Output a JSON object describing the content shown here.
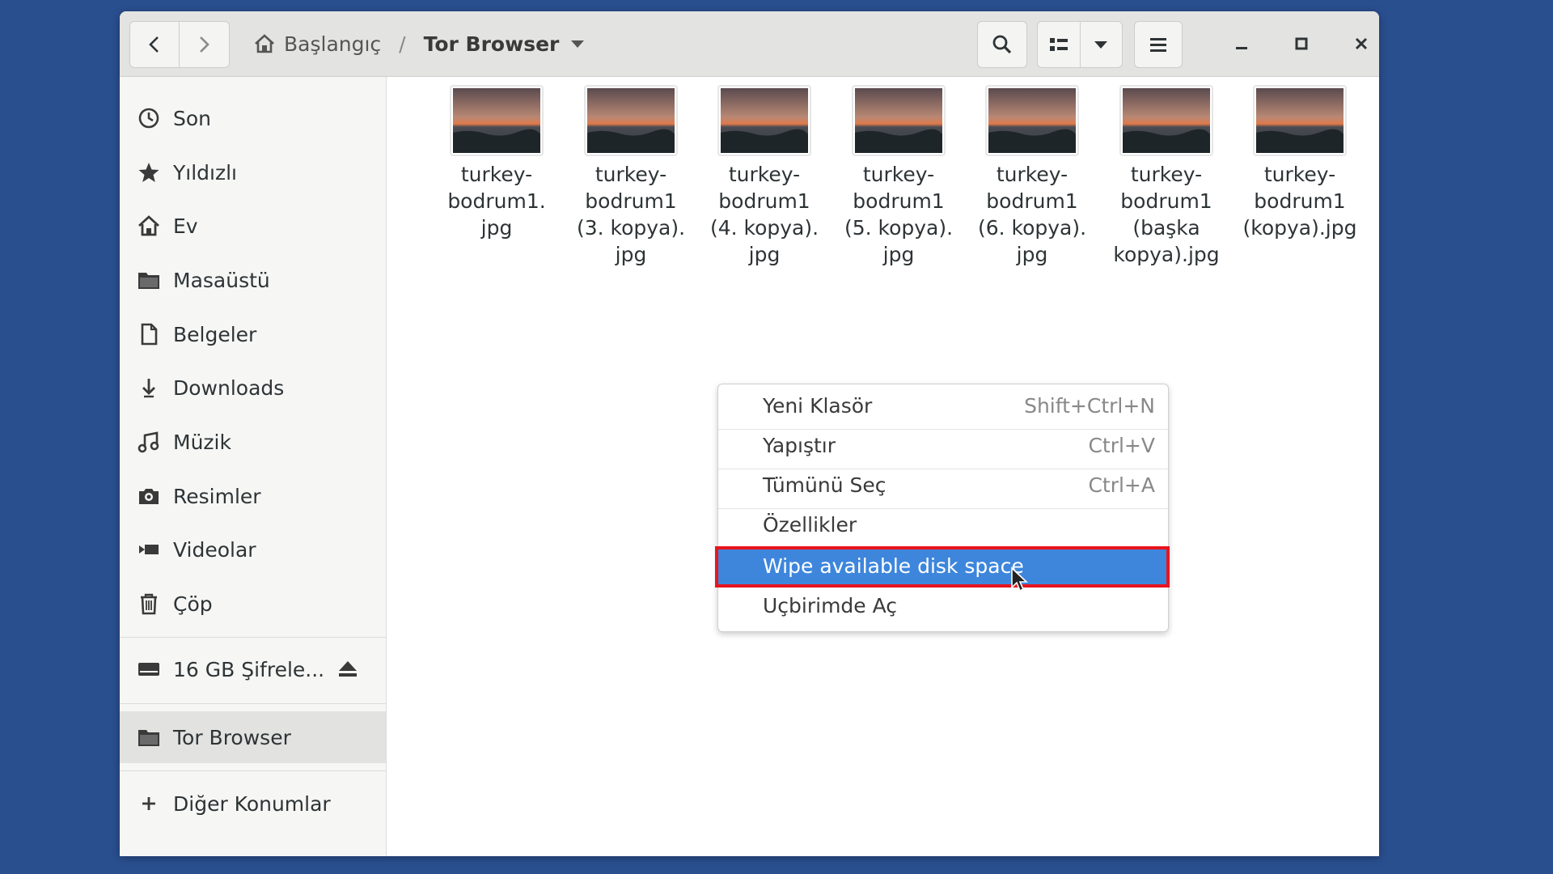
{
  "window": {
    "breadcrumb": {
      "home_label": "Başlangıç",
      "separator": "/",
      "current": "Tor Browser"
    }
  },
  "sidebar": {
    "items": [
      {
        "label": "Son",
        "icon": "clock-icon"
      },
      {
        "label": "Yıldızlı",
        "icon": "star-icon"
      },
      {
        "label": "Ev",
        "icon": "home-icon"
      },
      {
        "label": "Masaüstü",
        "icon": "folder-icon"
      },
      {
        "label": "Belgeler",
        "icon": "document-icon"
      },
      {
        "label": "Downloads",
        "icon": "download-icon"
      },
      {
        "label": "Müzik",
        "icon": "music-icon"
      },
      {
        "label": "Resimler",
        "icon": "camera-icon"
      },
      {
        "label": "Videolar",
        "icon": "video-icon"
      },
      {
        "label": "Çöp",
        "icon": "trash-icon"
      }
    ],
    "drive": {
      "label": "16 GB Şifrele...",
      "icon": "drive-icon",
      "action_icon": "eject-icon"
    },
    "bookmark": {
      "label": "Tor Browser",
      "icon": "folder-icon",
      "active": true
    },
    "other": {
      "label": "Diğer Konumlar",
      "icon": "plus-icon"
    }
  },
  "files": [
    {
      "lines": [
        "turkey-",
        "bodrum1.",
        "jpg"
      ]
    },
    {
      "lines": [
        "turkey-",
        "bodrum1",
        "(3. kopya).",
        "jpg"
      ]
    },
    {
      "lines": [
        "turkey-",
        "bodrum1",
        "(4. kopya).",
        "jpg"
      ]
    },
    {
      "lines": [
        "turkey-",
        "bodrum1",
        "(5. kopya).",
        "jpg"
      ]
    },
    {
      "lines": [
        "turkey-",
        "bodrum1",
        "(6. kopya).",
        "jpg"
      ]
    },
    {
      "lines": [
        "turkey-",
        "bodrum1",
        "(başka",
        "kopya).jpg"
      ]
    },
    {
      "lines": [
        "turkey-",
        "bodrum1",
        "(kopya).jpg"
      ]
    }
  ],
  "context_menu": {
    "items": [
      {
        "label": "Yeni Klasör",
        "shortcut": "Shift+Ctrl+N"
      },
      {
        "label": "Yapıştır",
        "shortcut": "Ctrl+V"
      },
      {
        "label": "Tümünü Seç",
        "shortcut": "Ctrl+A"
      },
      {
        "label": "Özellikler",
        "shortcut": ""
      },
      {
        "label": "Wipe available disk space",
        "shortcut": "",
        "highlighted": true
      },
      {
        "label": "Uçbirimde Aç",
        "shortcut": ""
      }
    ]
  },
  "colors": {
    "desktop": "#2a4f8f",
    "highlight": "#3d86dc",
    "annotation": "#e8141e"
  }
}
